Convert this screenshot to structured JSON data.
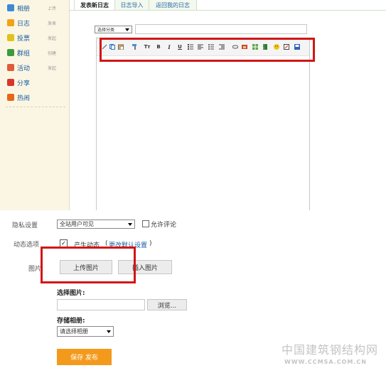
{
  "sidebar": {
    "items": [
      {
        "label": "相册",
        "action": "上传",
        "icon": "album-icon",
        "color": "#3c8ad6"
      },
      {
        "label": "日志",
        "action": "发表",
        "icon": "blog-icon",
        "color": "#f0a21b"
      },
      {
        "label": "投票",
        "action": "发起",
        "icon": "poll-icon",
        "color": "#e2c21a"
      },
      {
        "label": "群组",
        "action": "创建",
        "icon": "group-icon",
        "color": "#3d9b3d"
      },
      {
        "label": "活动",
        "action": "发起",
        "icon": "event-icon",
        "color": "#e15b3a"
      },
      {
        "label": "分享",
        "action": "",
        "icon": "share-icon",
        "color": "#d8362a"
      },
      {
        "label": "热闹",
        "action": "",
        "icon": "hot-icon",
        "color": "#e8661a"
      }
    ]
  },
  "tabs": [
    {
      "label": "发表新日志"
    },
    {
      "label": "日志导入"
    },
    {
      "label": "返回我的日志"
    }
  ],
  "category_select": {
    "value": "选择分类"
  },
  "toolbar_icons": [
    "cut-icon",
    "copy-icon",
    "paste-icon",
    "format-brush-icon",
    "font-size-icon",
    "bold-icon",
    "italic-icon",
    "underline-icon",
    "ordered-list-icon",
    "align-left-icon",
    "unordered-list-icon",
    "indent-icon",
    "link-icon",
    "image-icon",
    "table-icon",
    "video-icon",
    "emoticon-icon",
    "html-icon",
    "save-draft-icon"
  ],
  "toolbar_text": {
    "font_size": "Tт",
    "bold": "B",
    "italic": "I",
    "underline": "U"
  },
  "privacy": {
    "label": "隐私设置",
    "value": "全站用户可见",
    "checkbox_label": "允许评论"
  },
  "feed": {
    "label": "动态选项",
    "checkbox_label": "产生动态",
    "link": "更改默认设置"
  },
  "image": {
    "label": "图片",
    "upload_button": "上传图片",
    "insert_button": "插入图片",
    "choose_label": "选择图片:",
    "browse_button": "浏览...",
    "album_label": "存储相册:",
    "album_select": "请选择相册"
  },
  "submit_button": "保存 发布",
  "watermark": {
    "cn": "中国建筑钢结构网",
    "url": "WWW.CCMSA.COM.CN"
  },
  "colors": {
    "highlight": "#d21515",
    "submit": "#f39a1d",
    "link": "#1a5fa0",
    "sidebar_bg": "#fbf6e3"
  }
}
